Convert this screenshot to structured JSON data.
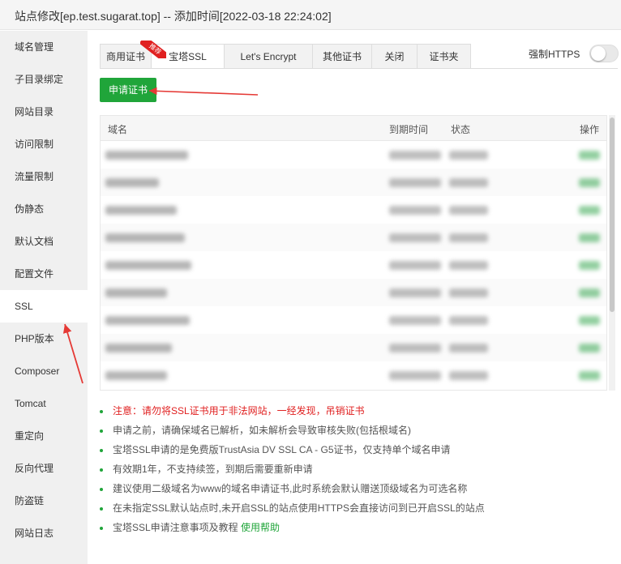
{
  "window": {
    "title": "站点修改[ep.test.sugarat.top] -- 添加时间[2022-03-18 22:24:02]"
  },
  "sidebar": {
    "items": [
      {
        "label": "域名管理"
      },
      {
        "label": "子目录绑定"
      },
      {
        "label": "网站目录"
      },
      {
        "label": "访问限制"
      },
      {
        "label": "流量限制"
      },
      {
        "label": "伪静态"
      },
      {
        "label": "默认文档"
      },
      {
        "label": "配置文件"
      },
      {
        "label": "SSL"
      },
      {
        "label": "PHP版本"
      },
      {
        "label": "Composer"
      },
      {
        "label": "Tomcat"
      },
      {
        "label": "重定向"
      },
      {
        "label": "反向代理"
      },
      {
        "label": "防盗链"
      },
      {
        "label": "网站日志"
      }
    ],
    "active": "SSL"
  },
  "tabs": [
    {
      "label": "商用证书"
    },
    {
      "label": "宝塔SSL"
    },
    {
      "label": "Let's Encrypt"
    },
    {
      "label": "其他证书"
    },
    {
      "label": "关闭"
    },
    {
      "label": "证书夹"
    }
  ],
  "active_tab": "宝塔SSL",
  "badge": {
    "label": "推荐"
  },
  "force_https": {
    "label": "强制HTTPS",
    "enabled": false
  },
  "apply_button": {
    "label": "申请证书"
  },
  "table": {
    "headers": {
      "domain": "域名",
      "expire": "到期时间",
      "status": "状态",
      "action": "操作"
    },
    "row_count": 9
  },
  "notes": [
    {
      "text": "注意：请勿将SSL证书用于非法网站，一经发现，吊销证书",
      "emphasis": true
    },
    {
      "text": "申请之前，请确保域名已解析，如未解析会导致审核失败(包括根域名)"
    },
    {
      "text": "宝塔SSL申请的是免费版TrustAsia DV SSL CA - G5证书，仅支持单个域名申请"
    },
    {
      "text": "有效期1年，不支持续签，到期后需要重新申请"
    },
    {
      "text": "建议使用二级域名为www的域名申请证书,此时系统会默认赠送顶级域名为可选名称"
    },
    {
      "text": "在未指定SSL默认站点时,未开启SSL的站点使用HTTPS会直接访问到已开启SSL的站点"
    },
    {
      "text": "宝塔SSL申请注意事项及教程",
      "link": "使用帮助"
    }
  ],
  "colors": {
    "accent": "#20a53a",
    "warning": "#e02020",
    "annotation": "#e53935"
  }
}
